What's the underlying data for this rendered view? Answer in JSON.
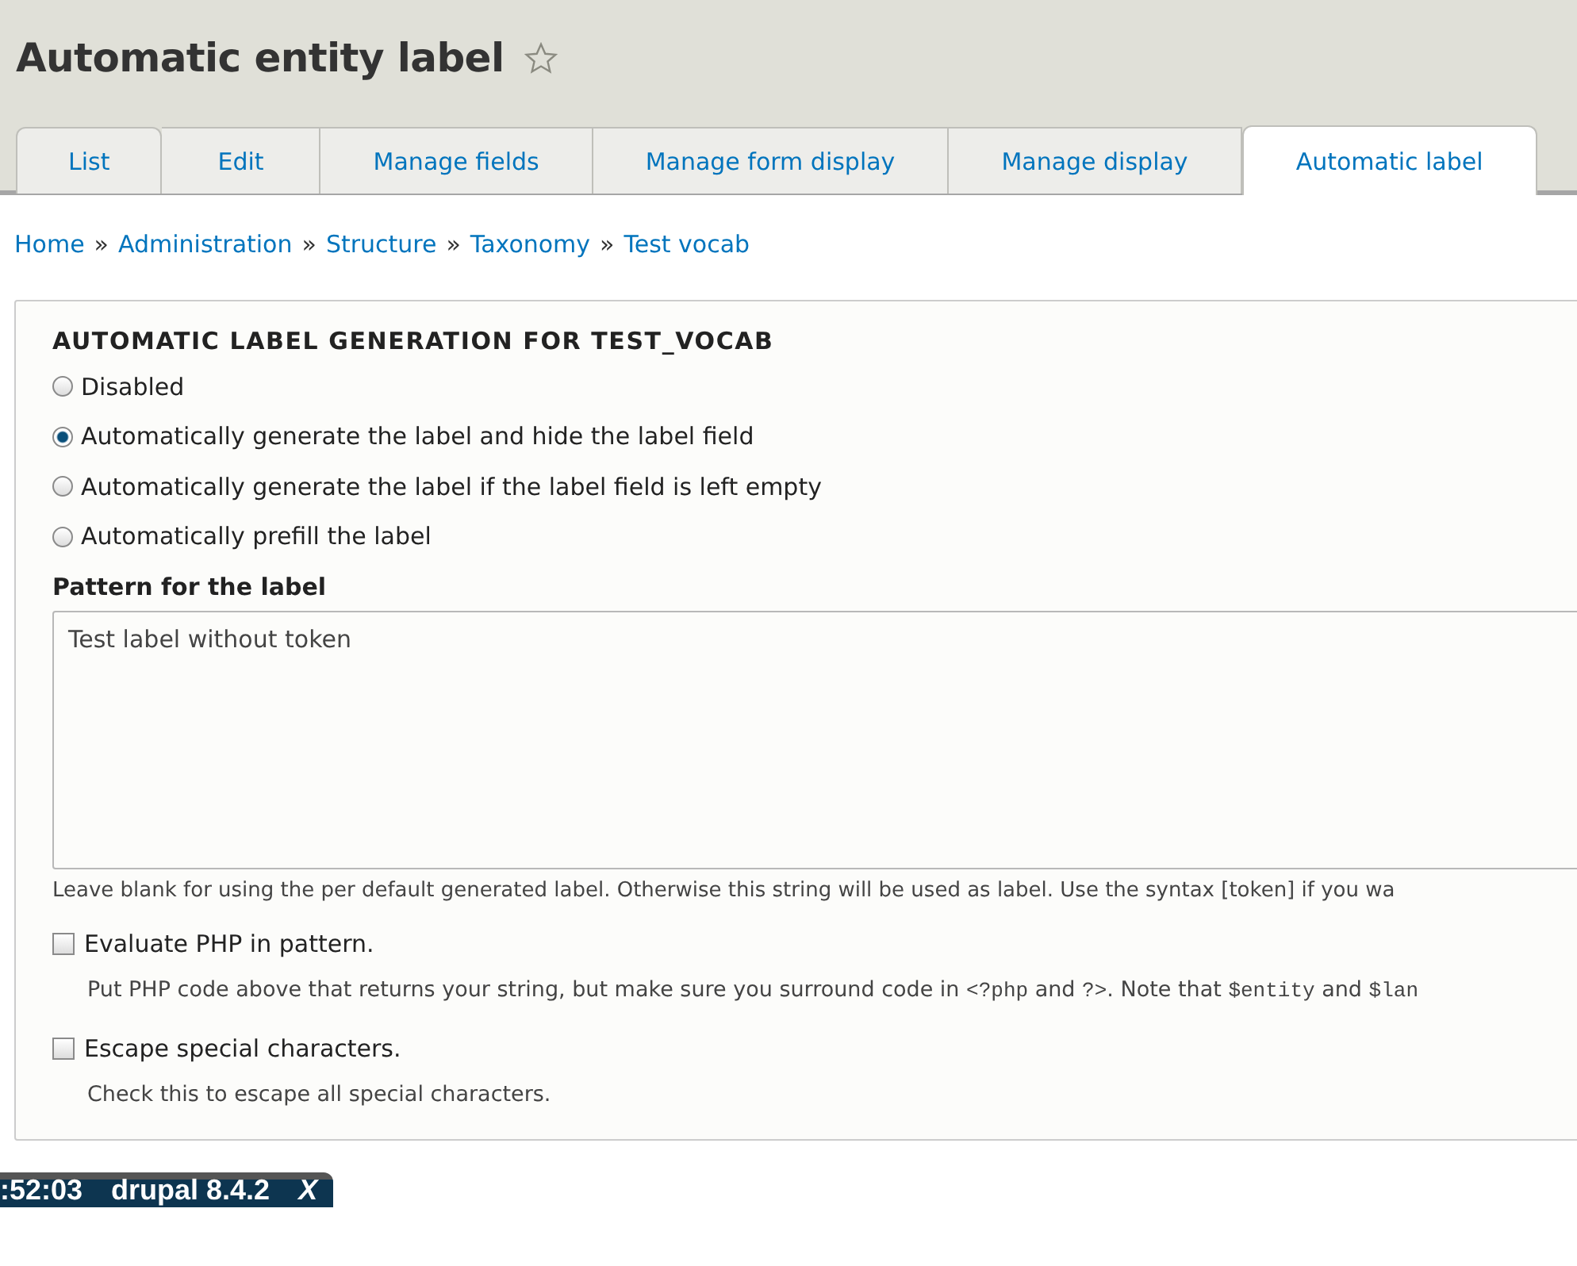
{
  "page_title": "Automatic entity label",
  "favorite": {
    "starred": false
  },
  "tabs": [
    {
      "label": "List",
      "selected": false
    },
    {
      "label": "Edit",
      "selected": false
    },
    {
      "label": "Manage fields",
      "selected": false
    },
    {
      "label": "Manage form display",
      "selected": false
    },
    {
      "label": "Manage display",
      "selected": false
    },
    {
      "label": "Automatic label",
      "selected": true
    }
  ],
  "breadcrumb": [
    "Home",
    "Administration",
    "Structure",
    "Taxonomy",
    "Test vocab"
  ],
  "breadcrumb_separator": "»",
  "fieldset": {
    "legend": "AUTOMATIC LABEL GENERATION FOR TEST_VOCAB",
    "options": [
      {
        "label": "Disabled",
        "selected": false
      },
      {
        "label": "Automatically generate the label and hide the label field",
        "selected": true
      },
      {
        "label": "Automatically generate the label if the label field is left empty",
        "selected": false
      },
      {
        "label": "Automatically prefill the label",
        "selected": false
      }
    ],
    "pattern": {
      "label": "Pattern for the label",
      "value": "Test label without token",
      "description": "Leave blank for using the per default generated label. Otherwise this string will be used as label. Use the syntax [token] if you wa"
    },
    "checkboxes": [
      {
        "label": "Evaluate PHP in pattern.",
        "checked": false,
        "description": [
          {
            "kind": "text",
            "text": "Put PHP code above that returns your string, but make sure you surround code in "
          },
          {
            "kind": "code",
            "text": "<?php"
          },
          {
            "kind": "text",
            "text": " and "
          },
          {
            "kind": "code",
            "text": "?>"
          },
          {
            "kind": "text",
            "text": ". Note that "
          },
          {
            "kind": "code",
            "text": "$entity"
          },
          {
            "kind": "text",
            "text": " and "
          },
          {
            "kind": "code",
            "text": "$lan"
          }
        ]
      },
      {
        "label": "Escape special characters.",
        "checked": false,
        "description": [
          {
            "kind": "text",
            "text": "Check this to escape all special characters."
          }
        ]
      }
    ]
  },
  "overlay_bar": {
    "time": ":52:03",
    "title": "drupal 8.4.2",
    "close": "X"
  }
}
